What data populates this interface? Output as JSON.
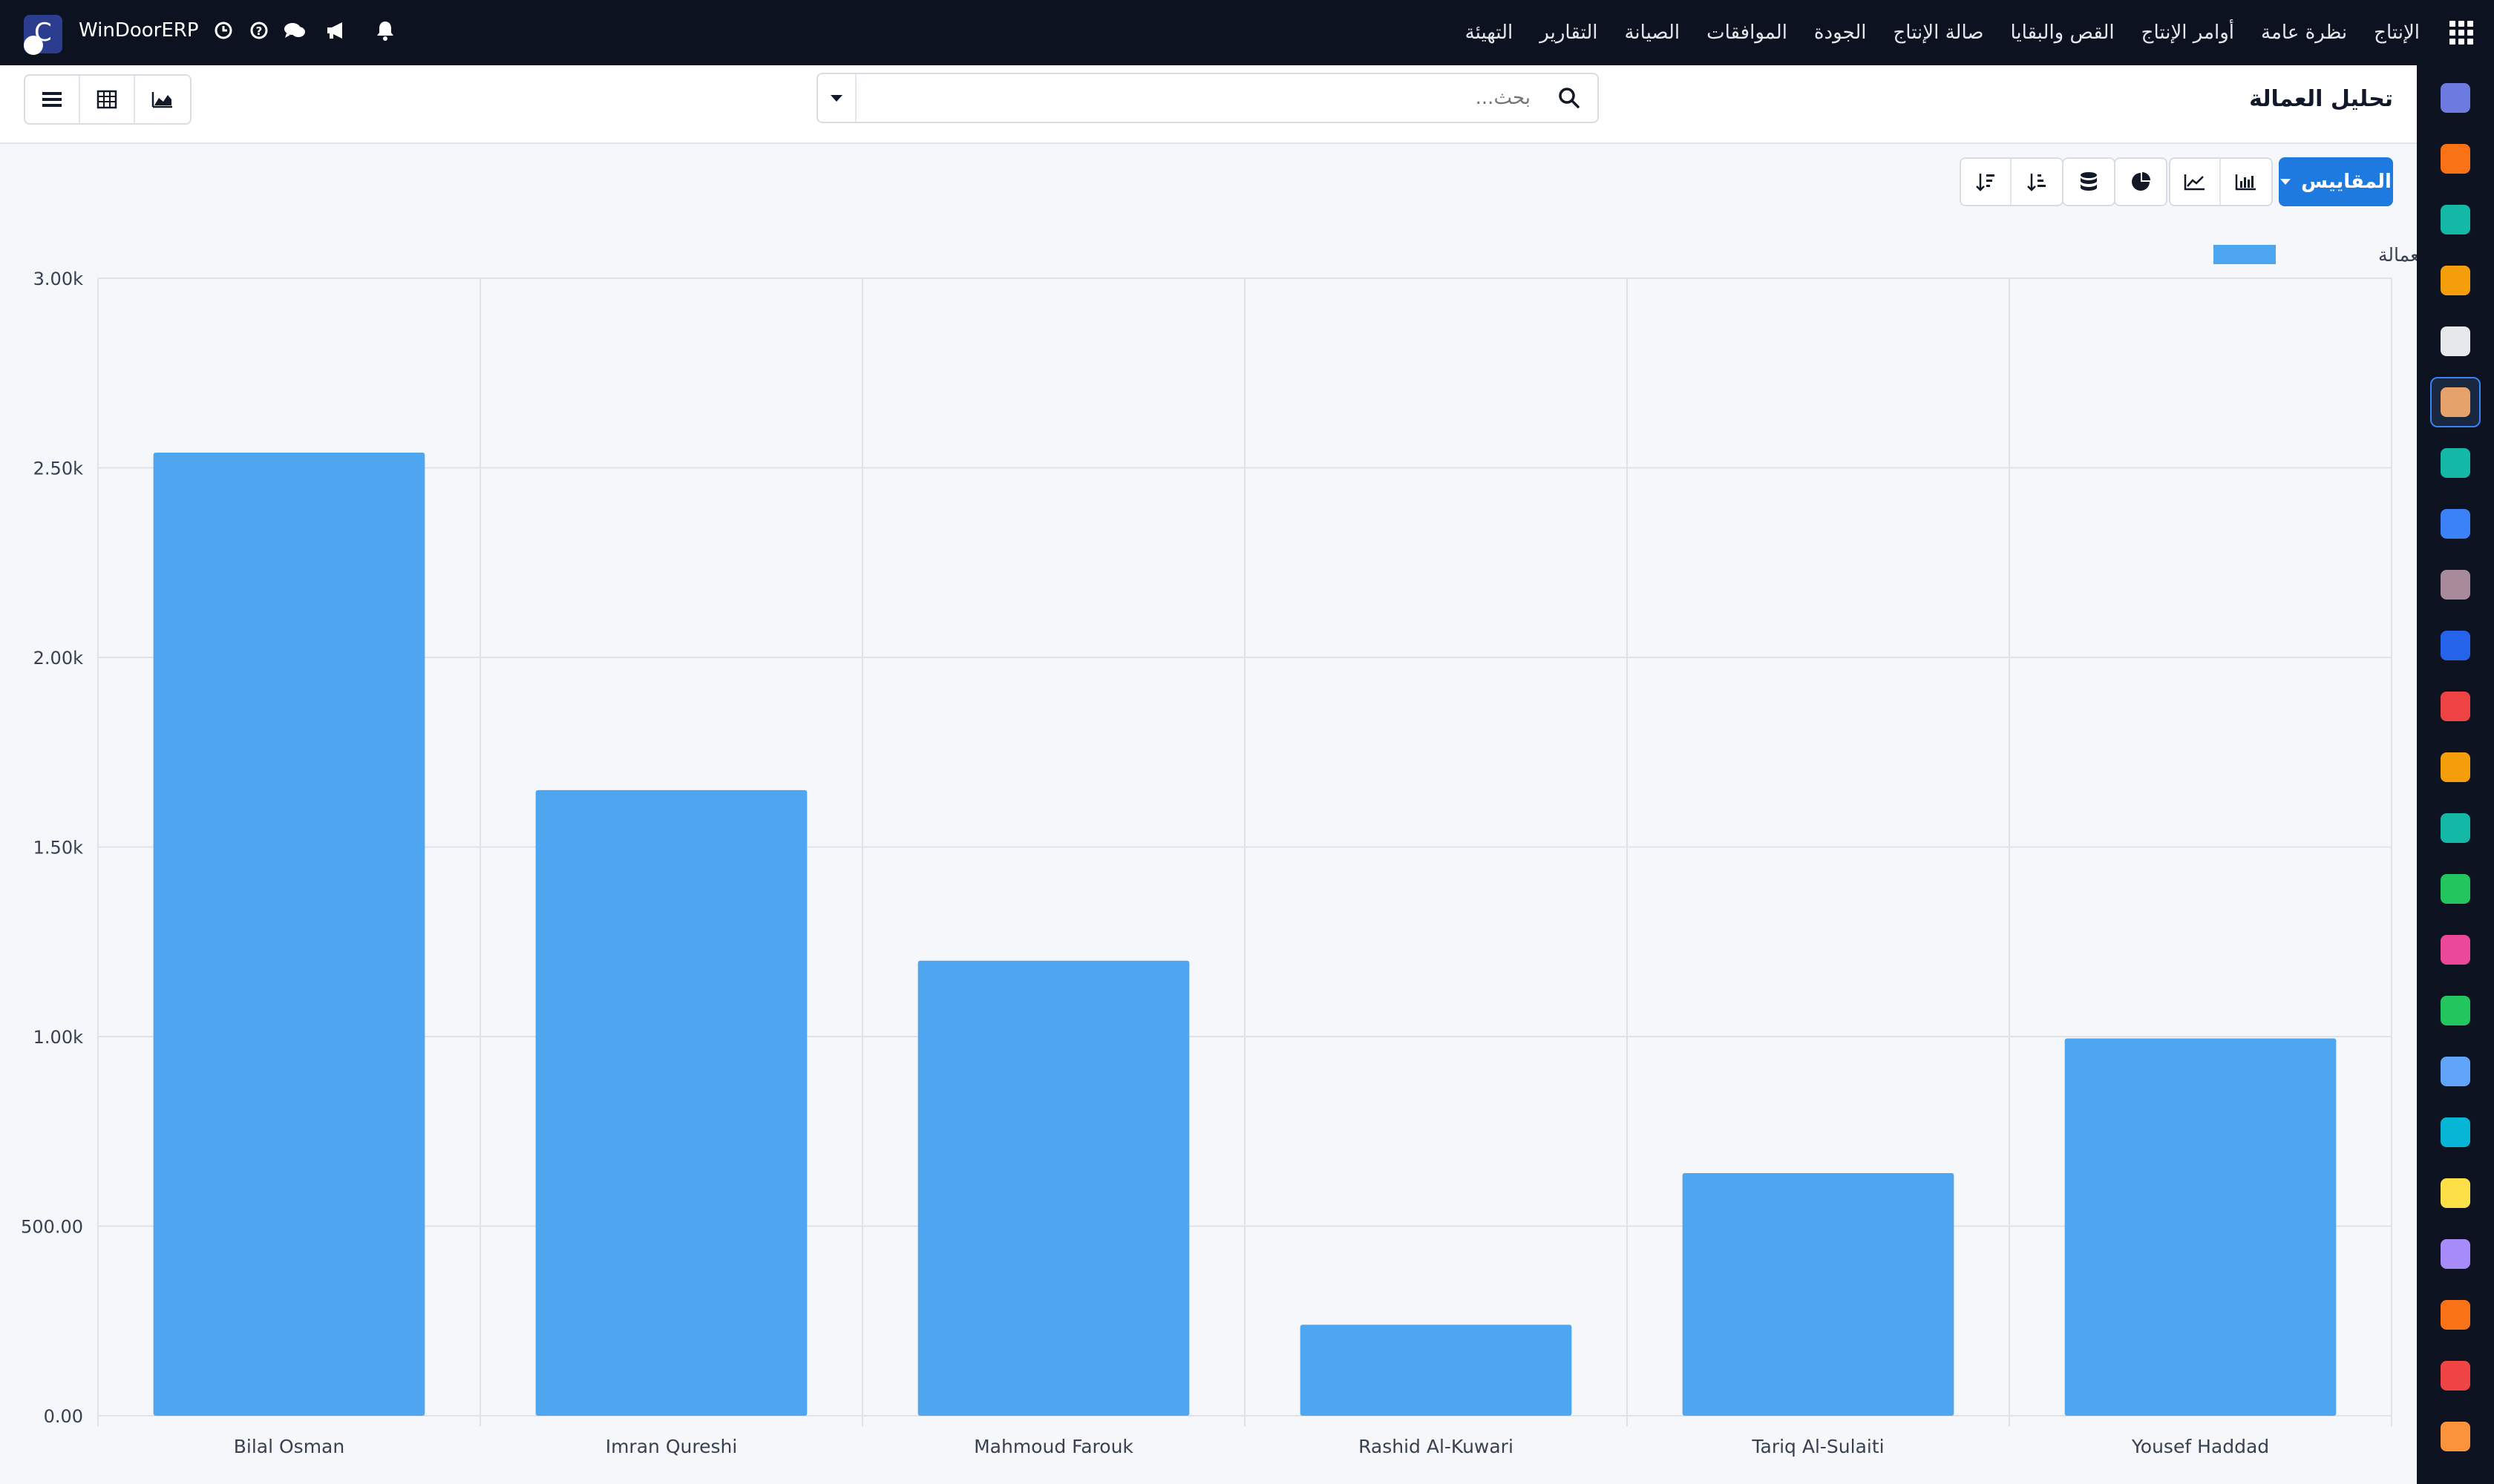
{
  "app": {
    "name": "WinDoorERP",
    "logo_letter": "C"
  },
  "topbar": {
    "menu": [
      {
        "label": "الإنتاج"
      },
      {
        "label": "نظرة عامة"
      },
      {
        "label": "أوامر الإنتاج"
      },
      {
        "label": "القص والبقايا"
      },
      {
        "label": "صالة الإنتاج"
      },
      {
        "label": "الجودة"
      },
      {
        "label": "الموافقات"
      },
      {
        "label": "الصيانة"
      },
      {
        "label": "التقارير"
      },
      {
        "label": "التهيئة"
      }
    ]
  },
  "control": {
    "page_title": "تحليل العمالة",
    "search_placeholder": "بحث..."
  },
  "toolbar": {
    "measures_label": "المقاييس"
  },
  "colors": {
    "bar": "#4ea5f0",
    "accent": "#1f7ae0",
    "navbar": "#0c1220"
  },
  "chart_data": {
    "type": "bar",
    "categories": [
      "Bilal Osman",
      "Imran Qureshi",
      "Mahmoud Farouk",
      "Rashid Al-Kuwari",
      "Tariq Al-Sulaiti",
      "Yousef Haddad"
    ],
    "series": [
      {
        "name": "تكلفة العمالة",
        "values": [
          2540,
          1650,
          1200,
          240,
          640,
          995
        ]
      }
    ],
    "ylim": [
      0,
      3000
    ],
    "yticks": [
      0,
      500,
      1000,
      1500,
      2000,
      2500,
      3000
    ],
    "ytick_labels": [
      "0.00",
      "500.00",
      "1.00k",
      "1.50k",
      "2.00k",
      "2.50k",
      "3.00k"
    ],
    "grid": true,
    "legend_position": "top-right",
    "xlabel": "",
    "ylabel": ""
  },
  "sidebar": {
    "apps": [
      {
        "icon": "m-app-icon",
        "color": "#6d7be0"
      },
      {
        "icon": "chat-bubble-icon",
        "color": "#f97316"
      },
      {
        "icon": "check-ribbon-icon",
        "color": "#14b8a6"
      },
      {
        "icon": "bar-chart-app-icon",
        "color": "#f59e0b"
      },
      {
        "icon": "cube-icon",
        "color": "#e5e7eb"
      },
      {
        "icon": "employees-icon",
        "color": "#e5a36b"
      },
      {
        "icon": "check-icon",
        "color": "#14b8a6"
      },
      {
        "icon": "book-icon",
        "color": "#3b82f6"
      },
      {
        "icon": "box-icon",
        "color": "#a78b9a"
      },
      {
        "icon": "invoice-icon",
        "color": "#2563eb"
      },
      {
        "icon": "team-icon",
        "color": "#ef4444"
      },
      {
        "icon": "calendar-icon",
        "color": "#f59e0b"
      },
      {
        "icon": "pen-icon",
        "color": "#14b8a6"
      },
      {
        "icon": "contact-icon",
        "color": "#22c55e"
      },
      {
        "icon": "dashboard-icon",
        "color": "#ec4899"
      },
      {
        "icon": "whatsapp-icon",
        "color": "#22c55e"
      },
      {
        "icon": "compass-icon",
        "color": "#60a5fa"
      },
      {
        "icon": "wave-icon",
        "color": "#06b6d4"
      },
      {
        "icon": "paper-plane-icon",
        "color": "#fde047"
      },
      {
        "icon": "card-icon",
        "color": "#a78bfa"
      },
      {
        "icon": "hexagon-icon",
        "color": "#f97316"
      },
      {
        "icon": "pie-app-icon",
        "color": "#ef4444"
      },
      {
        "icon": "hex-box-icon",
        "color": "#fb923c"
      }
    ]
  }
}
